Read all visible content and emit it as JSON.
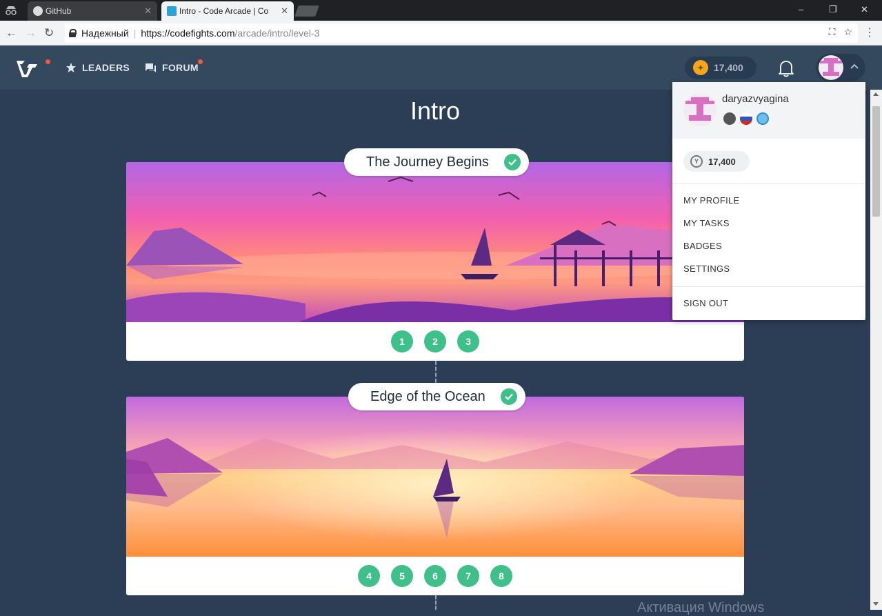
{
  "browser": {
    "tabs": [
      {
        "title": "GitHub",
        "active": false
      },
      {
        "title": "Intro - Code Arcade | Co",
        "active": true
      }
    ],
    "security_label": "Надежный",
    "url_host": "https://codefights.com",
    "url_path": "/arcade/intro/level-3",
    "window_controls": [
      "–",
      "❐",
      "✕"
    ]
  },
  "header": {
    "nav": [
      {
        "label": "LEADERS",
        "icon": "star-icon"
      },
      {
        "label": "FORUM",
        "icon": "forum-icon"
      }
    ],
    "coins": "17,400",
    "accent": "#f05a40"
  },
  "main": {
    "title": "Intro",
    "levels": [
      {
        "name": "The Journey Begins",
        "completed": true,
        "steps": [
          "1",
          "2",
          "3"
        ]
      },
      {
        "name": "Edge of the Ocean",
        "completed": true,
        "steps": [
          "4",
          "5",
          "6",
          "7",
          "8"
        ]
      }
    ],
    "step_color": "#3fbf8a"
  },
  "user_menu": {
    "username": "daryazvyagina",
    "badges": [
      "shield-badge",
      "russia-flag-badge",
      "globe-badge"
    ],
    "coins": "17,400",
    "items": [
      "MY PROFILE",
      "MY TASKS",
      "BADGES",
      "SETTINGS"
    ],
    "sign_out": "SIGN OUT"
  },
  "os": {
    "watermark": "Активация Windows"
  }
}
